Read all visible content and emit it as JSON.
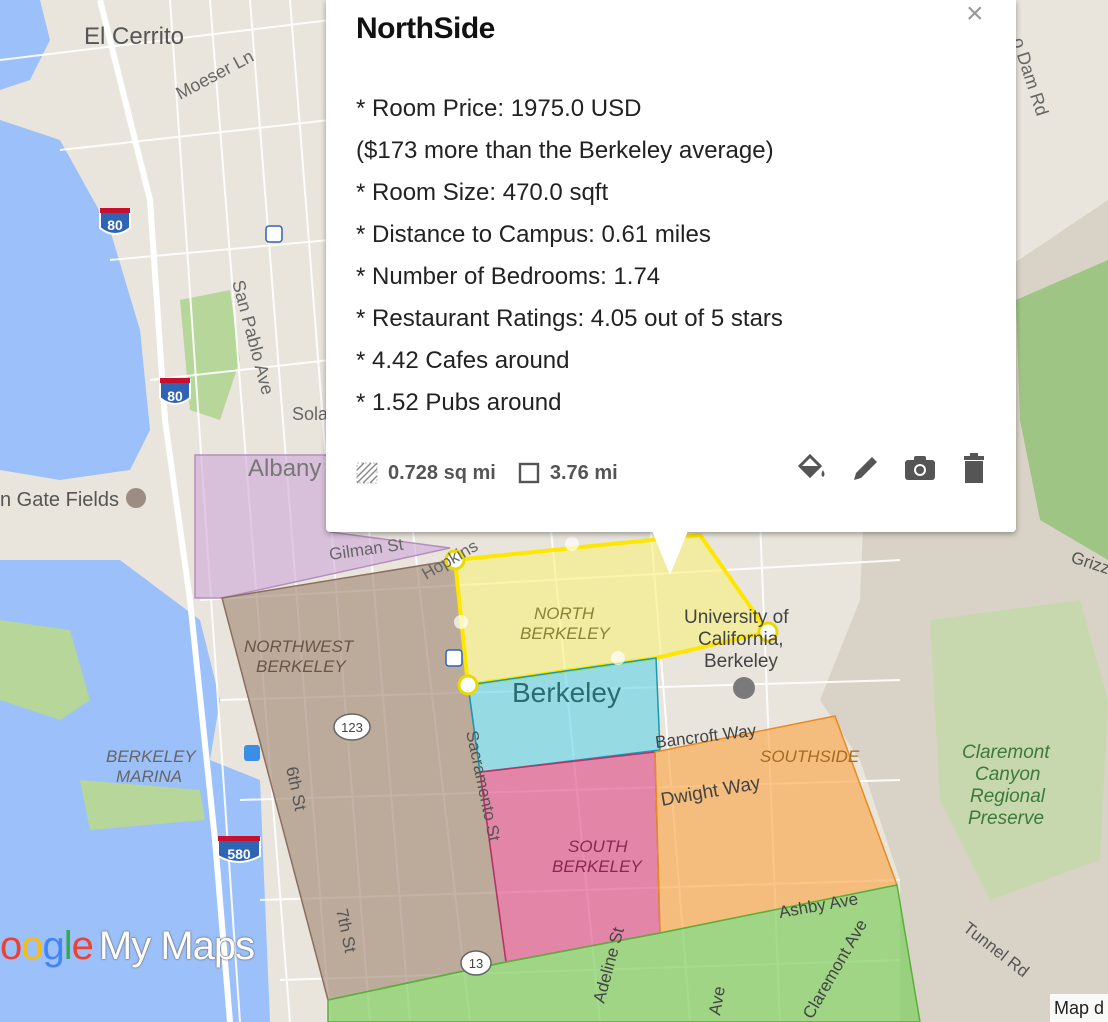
{
  "popup": {
    "title": "NorthSide",
    "close_symbol": "×",
    "lines": [
      "* Room Price: 1975.0 USD",
      "($173 more than the Berkeley average)",
      "* Room Size: 470.0 sqft",
      "* Distance to Campus: 0.61 miles",
      "* Number of Bedrooms: 1.74",
      "* Restaurant Ratings: 4.05 out of 5 stars",
      "* 4.42 Cafes around",
      "* 1.52 Pubs around"
    ],
    "area": "0.728 sq mi",
    "perimeter": "3.76 mi",
    "actions": [
      "paint-bucket-icon",
      "pencil-icon",
      "camera-icon",
      "trash-icon"
    ]
  },
  "regions": {
    "north_berkeley": "NORTH\nBERKELEY",
    "northwest_berkeley": "NORTHWEST\nBERKELEY",
    "south_berkeley": "SOUTH\nBERKELEY",
    "southside": "SOUTHSIDE",
    "berkeley_marina": "BERKELEY\nMARINA"
  },
  "labels": {
    "el_cerrito": "El Cerrito",
    "moeser": "Moeser Ln",
    "dam_rd": "o Dam Rd",
    "san_pablo": "San Pablo Ave",
    "sola": "Sola",
    "albany": "Albany",
    "gate_fields": "n Gate Fields",
    "gilman": "Gilman St",
    "hopkins": "Hopkins",
    "university": "University of California, Berkeley",
    "berkeley": "Berkeley",
    "bancroft": "Bancroft Way",
    "dwight": "Dwight Way",
    "sacramento": "Sacramento St",
    "sixth": "6th St",
    "seventh": "7th St",
    "ashby": "Ashby Ave",
    "adeline": "Adeline St",
    "ave": "Ave",
    "claremont_ave": "Claremont Ave",
    "claremont_canyon": "Claremont\nCanyon\nRegional\nPreserve",
    "tunnel": "Tunnel Rd",
    "grizz": "Grizz"
  },
  "shields": {
    "i80_a": "80",
    "i80_b": "80",
    "i580": "580",
    "r123": "123",
    "r13": "13"
  },
  "branding": {
    "g1": "o",
    "g2": "o",
    "g3": "g",
    "g4": "l",
    "g5": "e",
    "my_maps": "My Maps",
    "map_data": "Map d"
  },
  "colors": {
    "water": "#9cc0f9",
    "land": "#e9e5dc",
    "park": "#b6d69a",
    "north": "#f7f07a",
    "northwest": "#a58a78",
    "albany": "#cfa6d8",
    "downtown": "#5fd3e8",
    "south": "#e0528a",
    "southside": "#fba84a",
    "bottom": "#7fce5f"
  }
}
